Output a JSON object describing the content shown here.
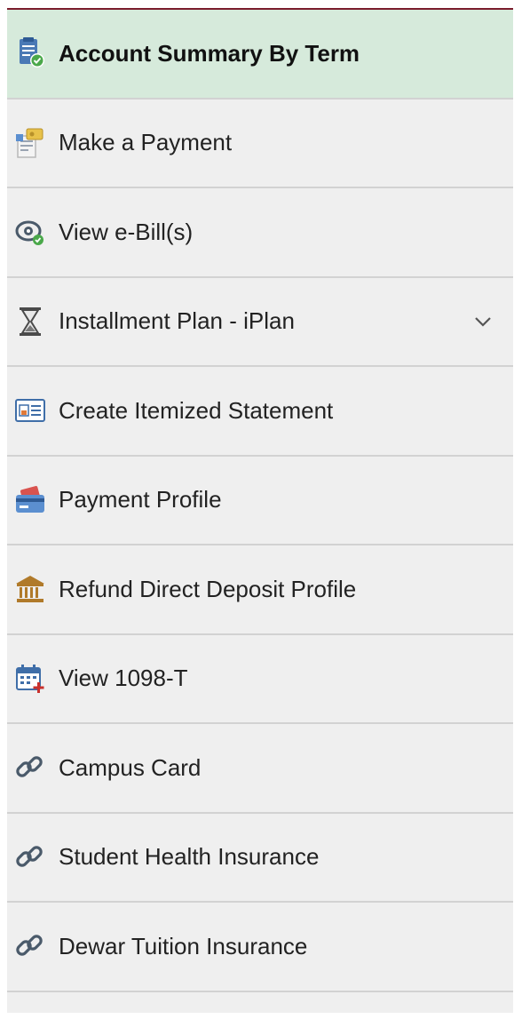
{
  "nav": {
    "accent_color": "#7a1c2c",
    "active_bg": "#d6eadb",
    "items": [
      {
        "label": "Account Summary By Term",
        "icon": "document-check-icon",
        "active": true
      },
      {
        "label": "Make a Payment",
        "icon": "payment-icon"
      },
      {
        "label": "View e-Bill(s)",
        "icon": "eye-check-icon"
      },
      {
        "label": "Installment Plan - iPlan",
        "icon": "hourglass-icon",
        "expandable": true
      },
      {
        "label": "Create Itemized Statement",
        "icon": "id-card-icon"
      },
      {
        "label": "Payment Profile",
        "icon": "credit-card-icon"
      },
      {
        "label": "Refund Direct Deposit Profile",
        "icon": "bank-icon"
      },
      {
        "label": "View 1098-T",
        "icon": "calendar-add-icon"
      },
      {
        "label": "Campus Card",
        "icon": "link-icon"
      },
      {
        "label": "Student Health Insurance",
        "icon": "link-icon"
      },
      {
        "label": "Dewar Tuition Insurance",
        "icon": "link-icon"
      }
    ]
  }
}
